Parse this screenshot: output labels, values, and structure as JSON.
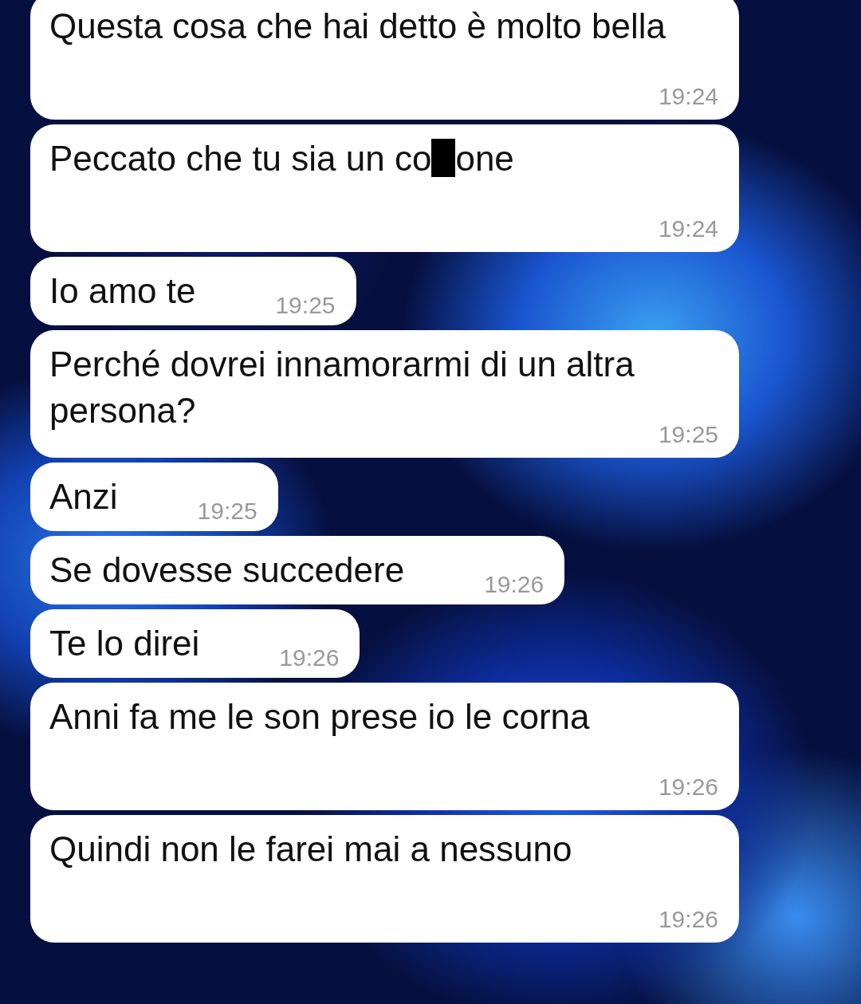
{
  "messages": [
    {
      "kind": "full",
      "parts": [
        {
          "kind": "text",
          "text": "Questa cosa che hai detto è molto bella"
        }
      ],
      "time": "19:24"
    },
    {
      "kind": "full",
      "parts": [
        {
          "kind": "text",
          "text": "Peccato che tu sia un co"
        },
        {
          "kind": "redaction"
        },
        {
          "kind": "text",
          "text": "one"
        }
      ],
      "time": "19:24"
    },
    {
      "kind": "inline",
      "parts": [
        {
          "kind": "text",
          "text": "Io amo te"
        }
      ],
      "time": "19:25"
    },
    {
      "kind": "full",
      "parts": [
        {
          "kind": "text",
          "text": "Perché dovrei innamorarmi di un altra persona?"
        }
      ],
      "time": "19:25"
    },
    {
      "kind": "inline",
      "parts": [
        {
          "kind": "text",
          "text": "Anzi"
        }
      ],
      "time": "19:25"
    },
    {
      "kind": "inline",
      "parts": [
        {
          "kind": "text",
          "text": "Se dovesse succedere"
        }
      ],
      "time": "19:26"
    },
    {
      "kind": "inline",
      "parts": [
        {
          "kind": "text",
          "text": "Te lo direi"
        }
      ],
      "time": "19:26"
    },
    {
      "kind": "full",
      "parts": [
        {
          "kind": "text",
          "text": "Anni fa me le son prese io le corna"
        }
      ],
      "time": "19:26"
    },
    {
      "kind": "full",
      "parts": [
        {
          "kind": "text",
          "text": "Quindi non le farei mai a nessuno"
        }
      ],
      "time": "19:26"
    }
  ]
}
